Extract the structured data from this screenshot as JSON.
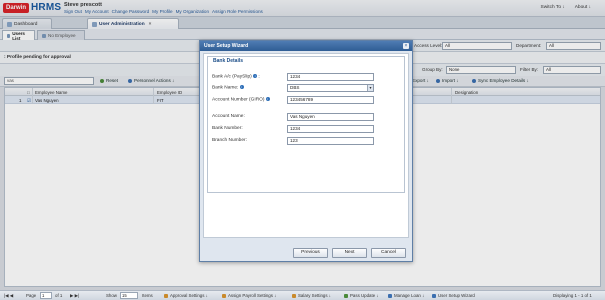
{
  "header": {
    "brand_badge": "Darwin",
    "brand_text": "HRMS",
    "user_name": "Steve prescott",
    "user_links": [
      "Sign Out",
      "My Account",
      "Change Password",
      "My Profile",
      "My Organization",
      "Assign Role Permissions"
    ],
    "switch_to": "Switch To ↓",
    "about": "About ↓"
  },
  "tabs": [
    {
      "label": "Dashboard",
      "active": false
    },
    {
      "label": "User Administration",
      "active": true
    }
  ],
  "subtabs": [
    {
      "label": "Users List",
      "active": true
    },
    {
      "label": "No Employee",
      "active": false
    }
  ],
  "filters": {
    "access_level_label": "Access Level:",
    "access_level_value": "All",
    "department_label": "Department:",
    "department_value": "All",
    "group_by_label": "Group By:",
    "group_by_value": "None",
    "filter_by_label": "Filter By:",
    "filter_by_value": "All"
  },
  "pending_label": ": Profile pending for approval",
  "toolbar": {
    "search_value": "vas",
    "reset": "Reset",
    "personnel_actions": "Personnel Actions ↓",
    "export": "Export ↓",
    "import": "Import ↓",
    "sync": "Sync Employee Details ↓"
  },
  "grid": {
    "headers": [
      "Employee Name",
      "Employee ID",
      "Designation"
    ],
    "rows": [
      {
        "num": "1",
        "name": "Vas Nguyen",
        "id": "FIT",
        "designation": ""
      }
    ]
  },
  "dialog": {
    "title": "User Setup Wizard",
    "section": "Bank Details",
    "fields": [
      {
        "label": "Bank A/c (PaySlip)",
        "value": "1234",
        "kind": "input"
      },
      {
        "label": "Bank Name:",
        "value": "DBS",
        "kind": "select"
      },
      {
        "label": "Account Number (GIRO)",
        "value": "123456789",
        "kind": "input"
      },
      {
        "label": "Account Name:",
        "value": "Vas Nguyen",
        "kind": "input"
      },
      {
        "label": "Bank Number:",
        "value": "1234",
        "kind": "input"
      },
      {
        "label": "Branch Number:",
        "value": "123",
        "kind": "input"
      }
    ],
    "buttons": {
      "previous": "Previous",
      "next": "Next",
      "cancel": "Cancel"
    }
  },
  "bottom": {
    "page_label": "Page",
    "page_value": "1",
    "of_label": "of 1",
    "show_label": "Show",
    "show_value": "15",
    "items_label": "Items",
    "actions": [
      "Approval Settings ↓",
      "Assign Payroll Settings ↓",
      "Salary Settings ↓",
      "Pass Update ↓",
      "Manage Loan ↓",
      "User Setup Wizard"
    ],
    "display": "Displaying 1 - 1 of 1"
  },
  "colors": {
    "brand_red": "#d8232a",
    "brand_blue": "#1a5aa0",
    "dialog_title": "#3a6aa3"
  }
}
